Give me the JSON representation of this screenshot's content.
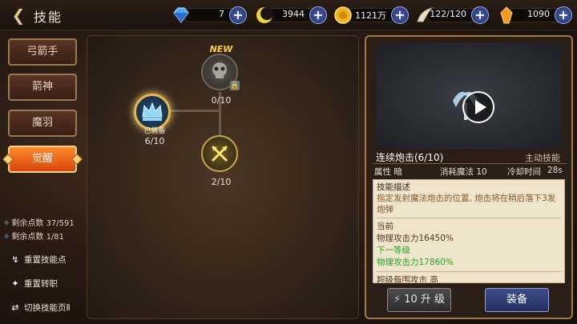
{
  "header": {
    "title": "技能"
  },
  "resources": [
    {
      "icon": "diamond-icon",
      "value": "7"
    },
    {
      "icon": "moon-coin-icon",
      "value": "3944"
    },
    {
      "icon": "gold-coin-icon",
      "value": "1121万"
    },
    {
      "icon": "wing-icon",
      "value": "122/120"
    },
    {
      "icon": "crystal-icon",
      "value": "1090"
    }
  ],
  "tabs": [
    {
      "label": "弓箭手"
    },
    {
      "label": "箭神"
    },
    {
      "label": "魔羽"
    },
    {
      "label": "觉醒",
      "active": true
    }
  ],
  "points": [
    {
      "label": "剩余点数 37/591"
    },
    {
      "label": "剩余点数 1/81"
    }
  ],
  "side_buttons": [
    {
      "label": "重置技能点"
    },
    {
      "label": "重置转职"
    },
    {
      "label": "切换技能页Ⅱ"
    }
  ],
  "tree": {
    "nodes": [
      {
        "id": "top",
        "badge": "NEW",
        "level": "0/10"
      },
      {
        "id": "left",
        "equipped_label": "已装备",
        "level": "6/10"
      },
      {
        "id": "middle",
        "level": "2/10"
      }
    ]
  },
  "skill_detail": {
    "name": "连续炮击(6/10)",
    "type": "主动技能",
    "attribute": "属性 暗",
    "mana_cost": "消耗魔法 10",
    "cooldown_label": "冷却时间",
    "cooldown": "28s",
    "desc_heading": "技能描述",
    "desc_text": "指定发射魔法炮击的位置, 炮击将在稍后落下3发炮弹",
    "current_label": "当前",
    "current_value": "物理攻击力16450%",
    "next_label": "下一等级",
    "next_value": "物理攻击力17860%",
    "cut_text": "超级每围攻击 高"
  },
  "buttons": {
    "upgrade_cost": "10",
    "upgrade_label": "升 级",
    "equip_label": "装备"
  }
}
